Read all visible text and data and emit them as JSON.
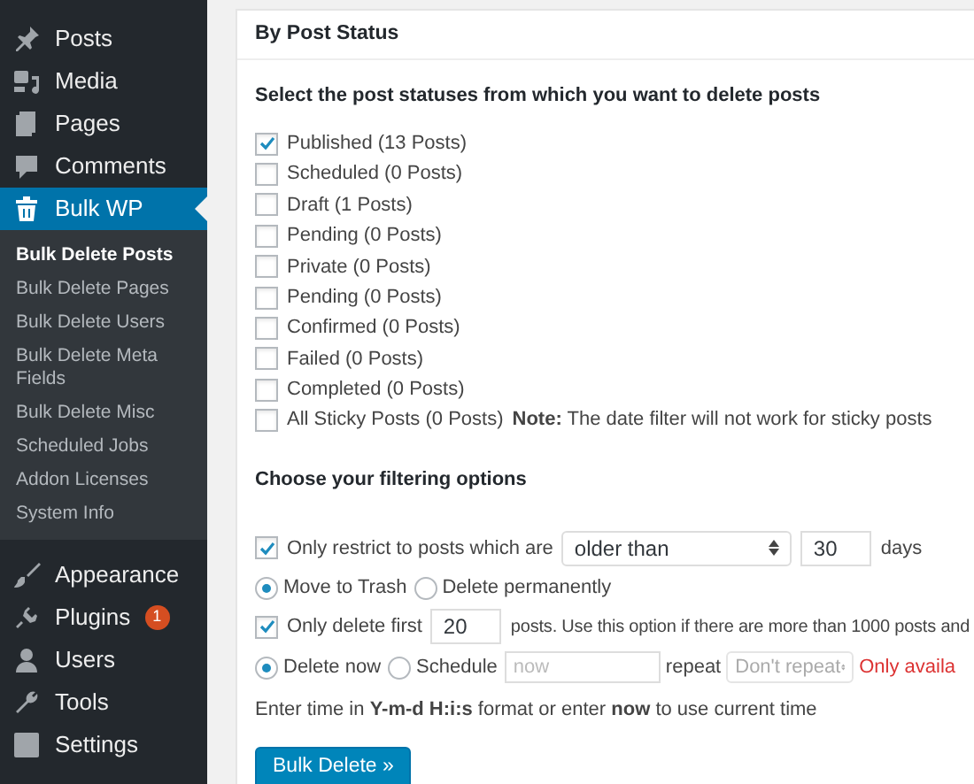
{
  "sidebar": {
    "items": [
      {
        "label": "Posts",
        "selected": false
      },
      {
        "label": "Media",
        "selected": false
      },
      {
        "label": "Pages",
        "selected": false
      },
      {
        "label": "Comments",
        "selected": false
      },
      {
        "label": "Bulk WP",
        "selected": true,
        "submenu": [
          {
            "label": "Bulk Delete Posts",
            "selected": true
          },
          {
            "label": "Bulk Delete Pages",
            "selected": false
          },
          {
            "label": "Bulk Delete Users",
            "selected": false
          },
          {
            "label": "Bulk Delete Meta Fields",
            "selected": false
          },
          {
            "label": "Bulk Delete Misc",
            "selected": false
          },
          {
            "label": "Scheduled Jobs",
            "selected": false
          },
          {
            "label": "Addon Licenses",
            "selected": false
          },
          {
            "label": "System Info",
            "selected": false
          }
        ]
      },
      {
        "label": "Appearance",
        "selected": false
      },
      {
        "label": "Plugins",
        "selected": false,
        "badge": "1"
      },
      {
        "label": "Users",
        "selected": false
      },
      {
        "label": "Tools",
        "selected": false
      },
      {
        "label": "Settings",
        "selected": false
      }
    ]
  },
  "panel": {
    "title": "By Post Status",
    "intro": "Select the post statuses from which you want to delete posts",
    "statuses": [
      {
        "label": "Published (13 Posts)",
        "checked": true
      },
      {
        "label": "Scheduled (0 Posts)",
        "checked": false
      },
      {
        "label": "Draft (1 Posts)",
        "checked": false
      },
      {
        "label": "Pending (0 Posts)",
        "checked": false
      },
      {
        "label": "Private (0 Posts)",
        "checked": false
      },
      {
        "label": "Pending (0 Posts)",
        "checked": false
      },
      {
        "label": "Confirmed (0 Posts)",
        "checked": false
      },
      {
        "label": "Failed (0 Posts)",
        "checked": false
      },
      {
        "label": "Completed (0 Posts)",
        "checked": false
      },
      {
        "label": "All Sticky Posts (0 Posts)",
        "checked": false,
        "note": "**Note:** The date filter will not work for sticky posts"
      }
    ],
    "filter_heading": "Choose your filtering options",
    "restrict": {
      "checked": true,
      "label": "Only restrict to posts which are",
      "select": "older than",
      "value": "30",
      "suffix": "days"
    },
    "delete_mode": [
      {
        "label": "Move to Trash",
        "selected": true
      },
      {
        "label": "Delete permanently",
        "selected": false
      }
    ],
    "limit": {
      "checked": true,
      "label": "Only delete first",
      "value": "20",
      "suffix": "posts. Use this option if there are more than 1000 posts and"
    },
    "timing": [
      {
        "label": "Delete now",
        "selected": true
      },
      {
        "label": "Schedule",
        "selected": false
      }
    ],
    "schedule_field": {
      "placeholder": "now"
    },
    "repeat_label": "repeat",
    "repeat_select": "Don't repeat",
    "warning": "Only availa",
    "help": "Enter time in **Y-m-d H:i:s** format or enter **now** to use current time",
    "button": "Bulk Delete »"
  }
}
